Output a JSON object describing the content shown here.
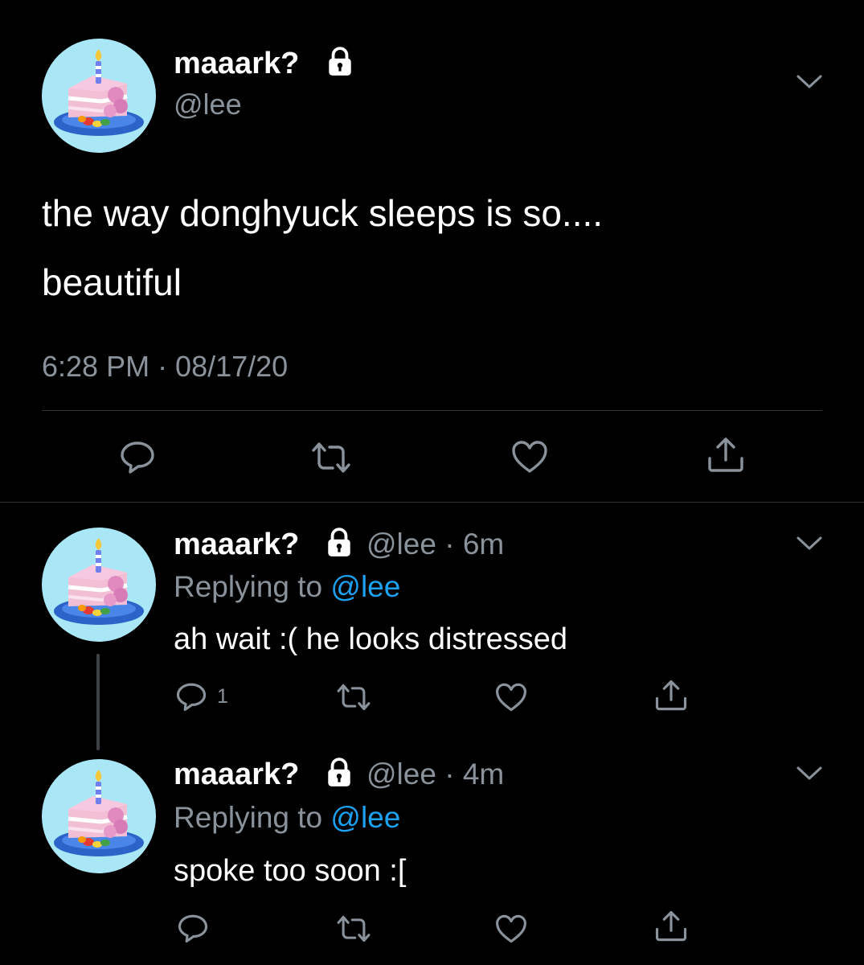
{
  "main_tweet": {
    "display_name": "maaark?",
    "handle": "@lee",
    "text_line1": "the way donghyuck sleeps is so....",
    "text_line2": "beautiful",
    "timestamp": "6:28 PM · 08/17/20"
  },
  "replies": [
    {
      "display_name": "maaark?",
      "handle": "@lee",
      "age": "· 6m",
      "replying_prefix": "Replying to",
      "replying_to": "@lee",
      "text": "ah wait :( he looks distressed",
      "reply_count": "1"
    },
    {
      "display_name": "maaark?",
      "handle": "@lee",
      "age": "· 4m",
      "replying_prefix": "Replying to",
      "replying_to": "@lee",
      "text": "spoke too soon :["
    }
  ],
  "icons": {
    "reply": "reply-icon",
    "retweet": "retweet-icon",
    "like": "heart-icon",
    "share": "share-icon",
    "more": "chevron-down-icon",
    "protected": "lock-icon"
  },
  "colors": {
    "background": "#000000",
    "text": "#ffffff",
    "muted": "#8a939b",
    "link": "#1da1f2",
    "avatar_bg": "#a9e7f6"
  }
}
